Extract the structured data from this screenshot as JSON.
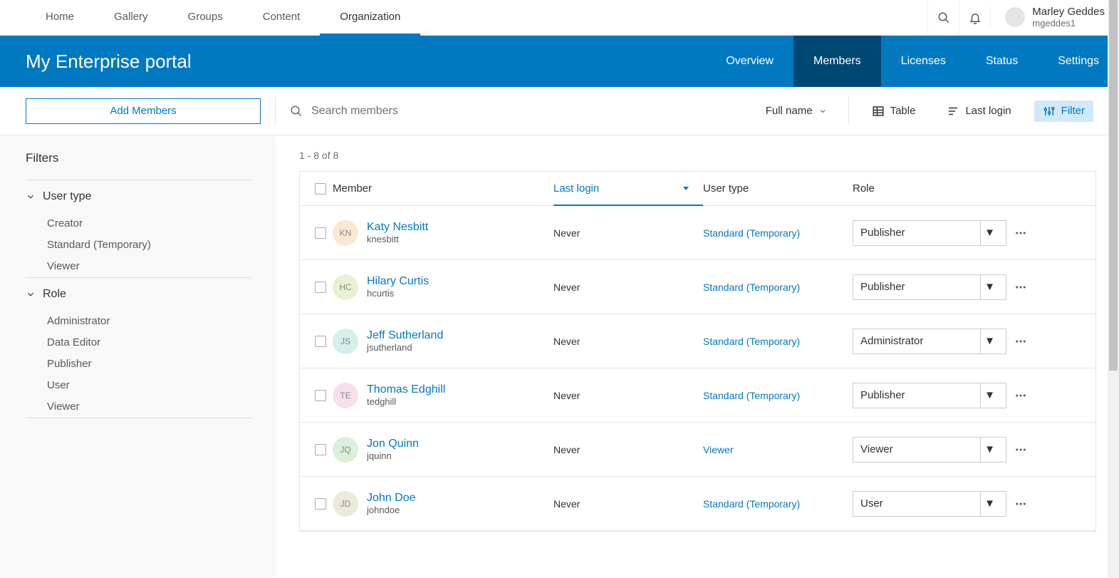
{
  "nav": {
    "items": [
      "Home",
      "Gallery",
      "Groups",
      "Content",
      "Organization"
    ],
    "activeIndex": 4
  },
  "currentUser": {
    "name": "Marley Geddes",
    "username": "mgeddes1"
  },
  "portal": {
    "title": "My Enterprise portal",
    "tabs": [
      "Overview",
      "Members",
      "Licenses",
      "Status",
      "Settings"
    ],
    "activeTabIndex": 1
  },
  "toolbar": {
    "addButton": "Add Members",
    "searchPlaceholder": "Search members",
    "sortBy": "Full name",
    "tableLabel": "Table",
    "lastLoginLabel": "Last login",
    "filterLabel": "Filter"
  },
  "filters": {
    "heading": "Filters",
    "groups": [
      {
        "label": "User type",
        "items": [
          "Creator",
          "Standard (Temporary)",
          "Viewer"
        ]
      },
      {
        "label": "Role",
        "items": [
          "Administrator",
          "Data Editor",
          "Publisher",
          "User",
          "Viewer"
        ]
      }
    ]
  },
  "paging": {
    "text": "1 - 8 of 8"
  },
  "columns": {
    "member": "Member",
    "lastLogin": "Last login",
    "userType": "User type",
    "role": "Role"
  },
  "members": [
    {
      "initials": "KN",
      "avatarBg": "#fbe8d3",
      "name": "Katy Nesbitt",
      "username": "knesbitt",
      "lastLogin": "Never",
      "userType": "Standard (Temporary)",
      "role": "Publisher"
    },
    {
      "initials": "HC",
      "avatarBg": "#e6f2d3",
      "name": "Hilary Curtis",
      "username": "hcurtis",
      "lastLogin": "Never",
      "userType": "Standard (Temporary)",
      "role": "Publisher"
    },
    {
      "initials": "JS",
      "avatarBg": "#d5efe9",
      "name": "Jeff Sutherland",
      "username": "jsutherland",
      "lastLogin": "Never",
      "userType": "Standard (Temporary)",
      "role": "Administrator"
    },
    {
      "initials": "TE",
      "avatarBg": "#f7e0eb",
      "name": "Thomas Edghill",
      "username": "tedghill",
      "lastLogin": "Never",
      "userType": "Standard (Temporary)",
      "role": "Publisher"
    },
    {
      "initials": "JQ",
      "avatarBg": "#daf0dd",
      "name": "Jon Quinn",
      "username": "jquinn",
      "lastLogin": "Never",
      "userType": "Viewer",
      "role": "Viewer"
    },
    {
      "initials": "JD",
      "avatarBg": "#eceadb",
      "name": "John Doe",
      "username": "johndoe",
      "lastLogin": "Never",
      "userType": "Standard (Temporary)",
      "role": "User"
    }
  ]
}
